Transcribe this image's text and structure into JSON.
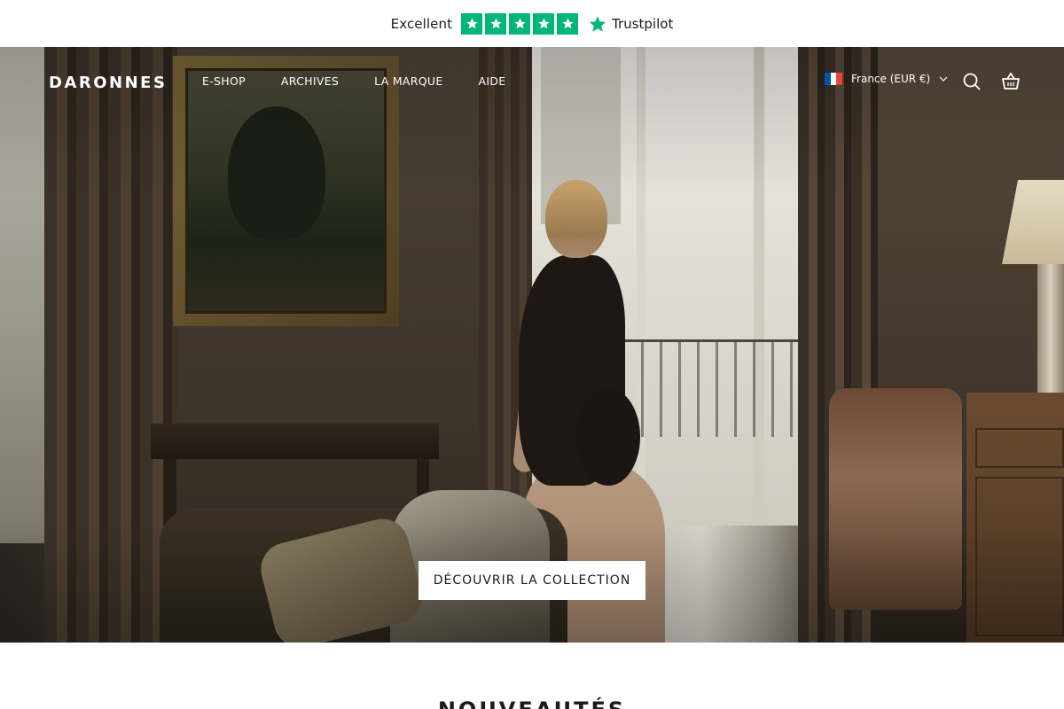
{
  "trustpilot": {
    "rating_label": "Excellent",
    "stars": 5,
    "brand": "Trustpilot",
    "star_color": "#00b67a"
  },
  "header": {
    "logo": "DARONNES",
    "nav": [
      {
        "label": "E-SHOP"
      },
      {
        "label": "ARCHIVES"
      },
      {
        "label": "LA MARQUE"
      },
      {
        "label": "AIDE"
      }
    ],
    "locale": {
      "label": "France (EUR €)",
      "flag_icon": "france-flag-icon",
      "dropdown_icon": "chevron-down-icon"
    },
    "icons": [
      "search-icon",
      "cart-icon"
    ]
  },
  "hero": {
    "cta_label": "DÉCOUVRIR LA COLLECTION"
  },
  "section": {
    "title": "NOUVEAUTÉS"
  }
}
